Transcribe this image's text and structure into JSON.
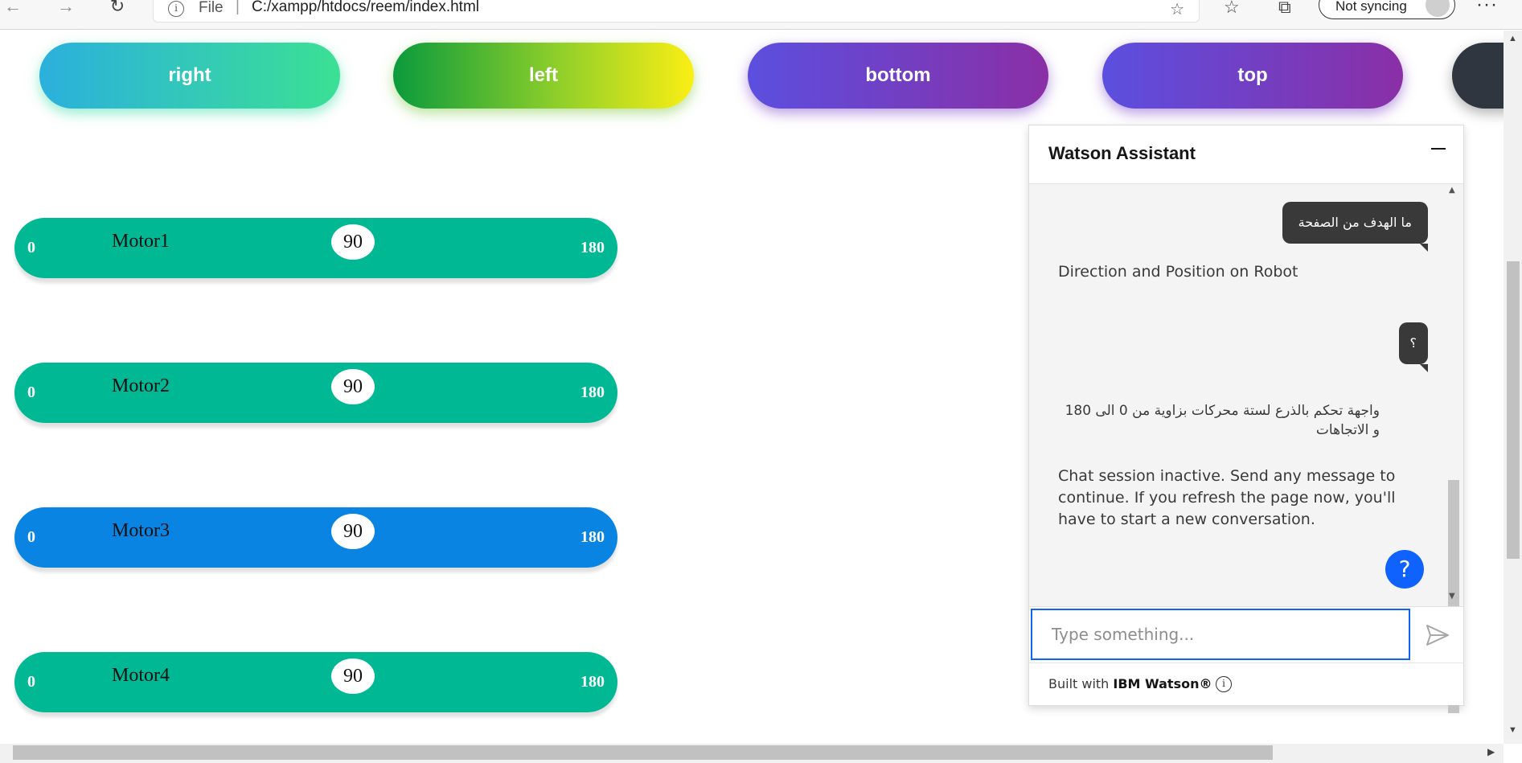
{
  "browser": {
    "file_label": "File",
    "separator": "|",
    "url": "C:/xampp/htdocs/reem/index.html",
    "sync_label": "Not syncing",
    "back_glyph": "←",
    "forward_glyph": "→",
    "reload_glyph": "↻",
    "more_glyph": "···"
  },
  "direction_buttons": [
    {
      "label": "right"
    },
    {
      "label": "left"
    },
    {
      "label": "bottom"
    },
    {
      "label": "top"
    },
    {
      "label": ""
    }
  ],
  "motors": [
    {
      "name": "Motor1",
      "min": "0",
      "max": "180",
      "value": "90",
      "color": "#00b894"
    },
    {
      "name": "Motor2",
      "min": "0",
      "max": "180",
      "value": "90",
      "color": "#00b894"
    },
    {
      "name": "Motor3",
      "min": "0",
      "max": "180",
      "value": "90",
      "color": "#0984e3"
    },
    {
      "name": "Motor4",
      "min": "0",
      "max": "180",
      "value": "90",
      "color": "#00b894"
    }
  ],
  "watson": {
    "title": "Watson Assistant",
    "messages": [
      {
        "from": "user",
        "text": "ما الهدف من الصفحة"
      },
      {
        "from": "bot",
        "text": "Direction and Position on Robot"
      },
      {
        "from": "user",
        "text": "؟"
      },
      {
        "from": "bot",
        "text": "واجهة تحكم بالذرع لستة محركات بزاوية من 0 الى 180 و الاتجاهات"
      },
      {
        "from": "bot",
        "text": "Chat session inactive. Send any message to continue. If you refresh the page now, you'll have to start a new conversation."
      }
    ],
    "input_placeholder": "Type something...",
    "footer_prefix": "Built with ",
    "footer_brand": "IBM Watson®",
    "help_glyph": "?",
    "accent_color": "#0f62fe"
  }
}
